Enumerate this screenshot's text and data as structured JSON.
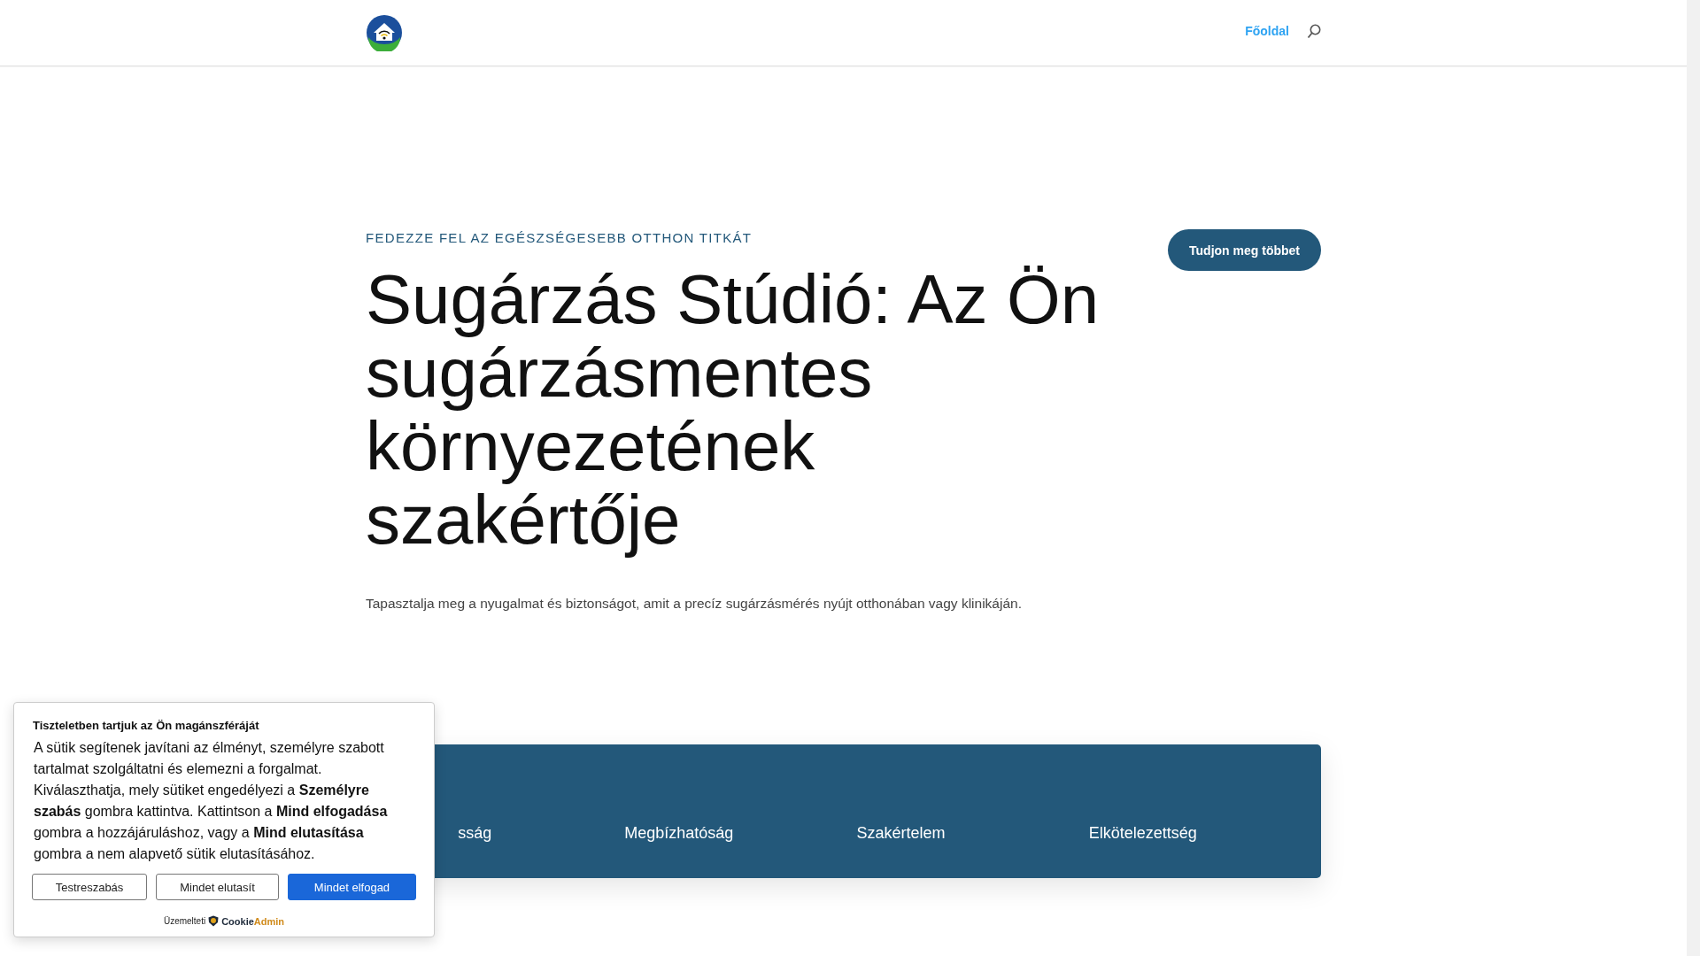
{
  "header": {
    "nav": [
      {
        "label": "Főoldal",
        "selected": true
      }
    ]
  },
  "hero": {
    "eyebrow": "FEDEZZE FEL AZ EGÉSZSÉGESEBB OTTHON TITKÁT",
    "title": "Sugárzás Stúdió: Az Ön sugárzásmentes környezetének szakértője",
    "subtitle": "Tapasztalja meg a nyugalmat és biztonságot, amit a precíz sugárzásmérés nyújt otthonában vagy klinikáján.",
    "button": "Tudjon meg többet"
  },
  "values": [
    {
      "label": "sság",
      "kind": "clipped"
    },
    {
      "label": "Megbízhatóság",
      "kind": "full"
    },
    {
      "label": "Szakértelem",
      "kind": "full"
    },
    {
      "label": "Elkötelezettség",
      "kind": "full"
    }
  ],
  "cookie": {
    "title": "Tiszteletben tartjuk az Ön magánszféráját",
    "text": "A sütik segítenek javítani az élményt, személyre szabott tartalmat szolgáltatni és elemezni a forgalmat. Kiválaszthatja, mely sütiket engedélyezi a **Személyre szabás** gombra kattintva. Kattintson a **Mind elfogadása** gombra a hozzájáruláshoz, vagy a **Mind elutasítása** gombra a nem alapvető sütik elutasításához.",
    "buttons": [
      {
        "label": "Testreszabás",
        "kind": "outline"
      },
      {
        "label": "Mindet elutasít",
        "kind": "outline"
      },
      {
        "label": "Mindet elfogad",
        "kind": "primary"
      }
    ],
    "powered": "Üzemelteti",
    "brand_a": "Cookie",
    "brand_b": "Admin"
  }
}
